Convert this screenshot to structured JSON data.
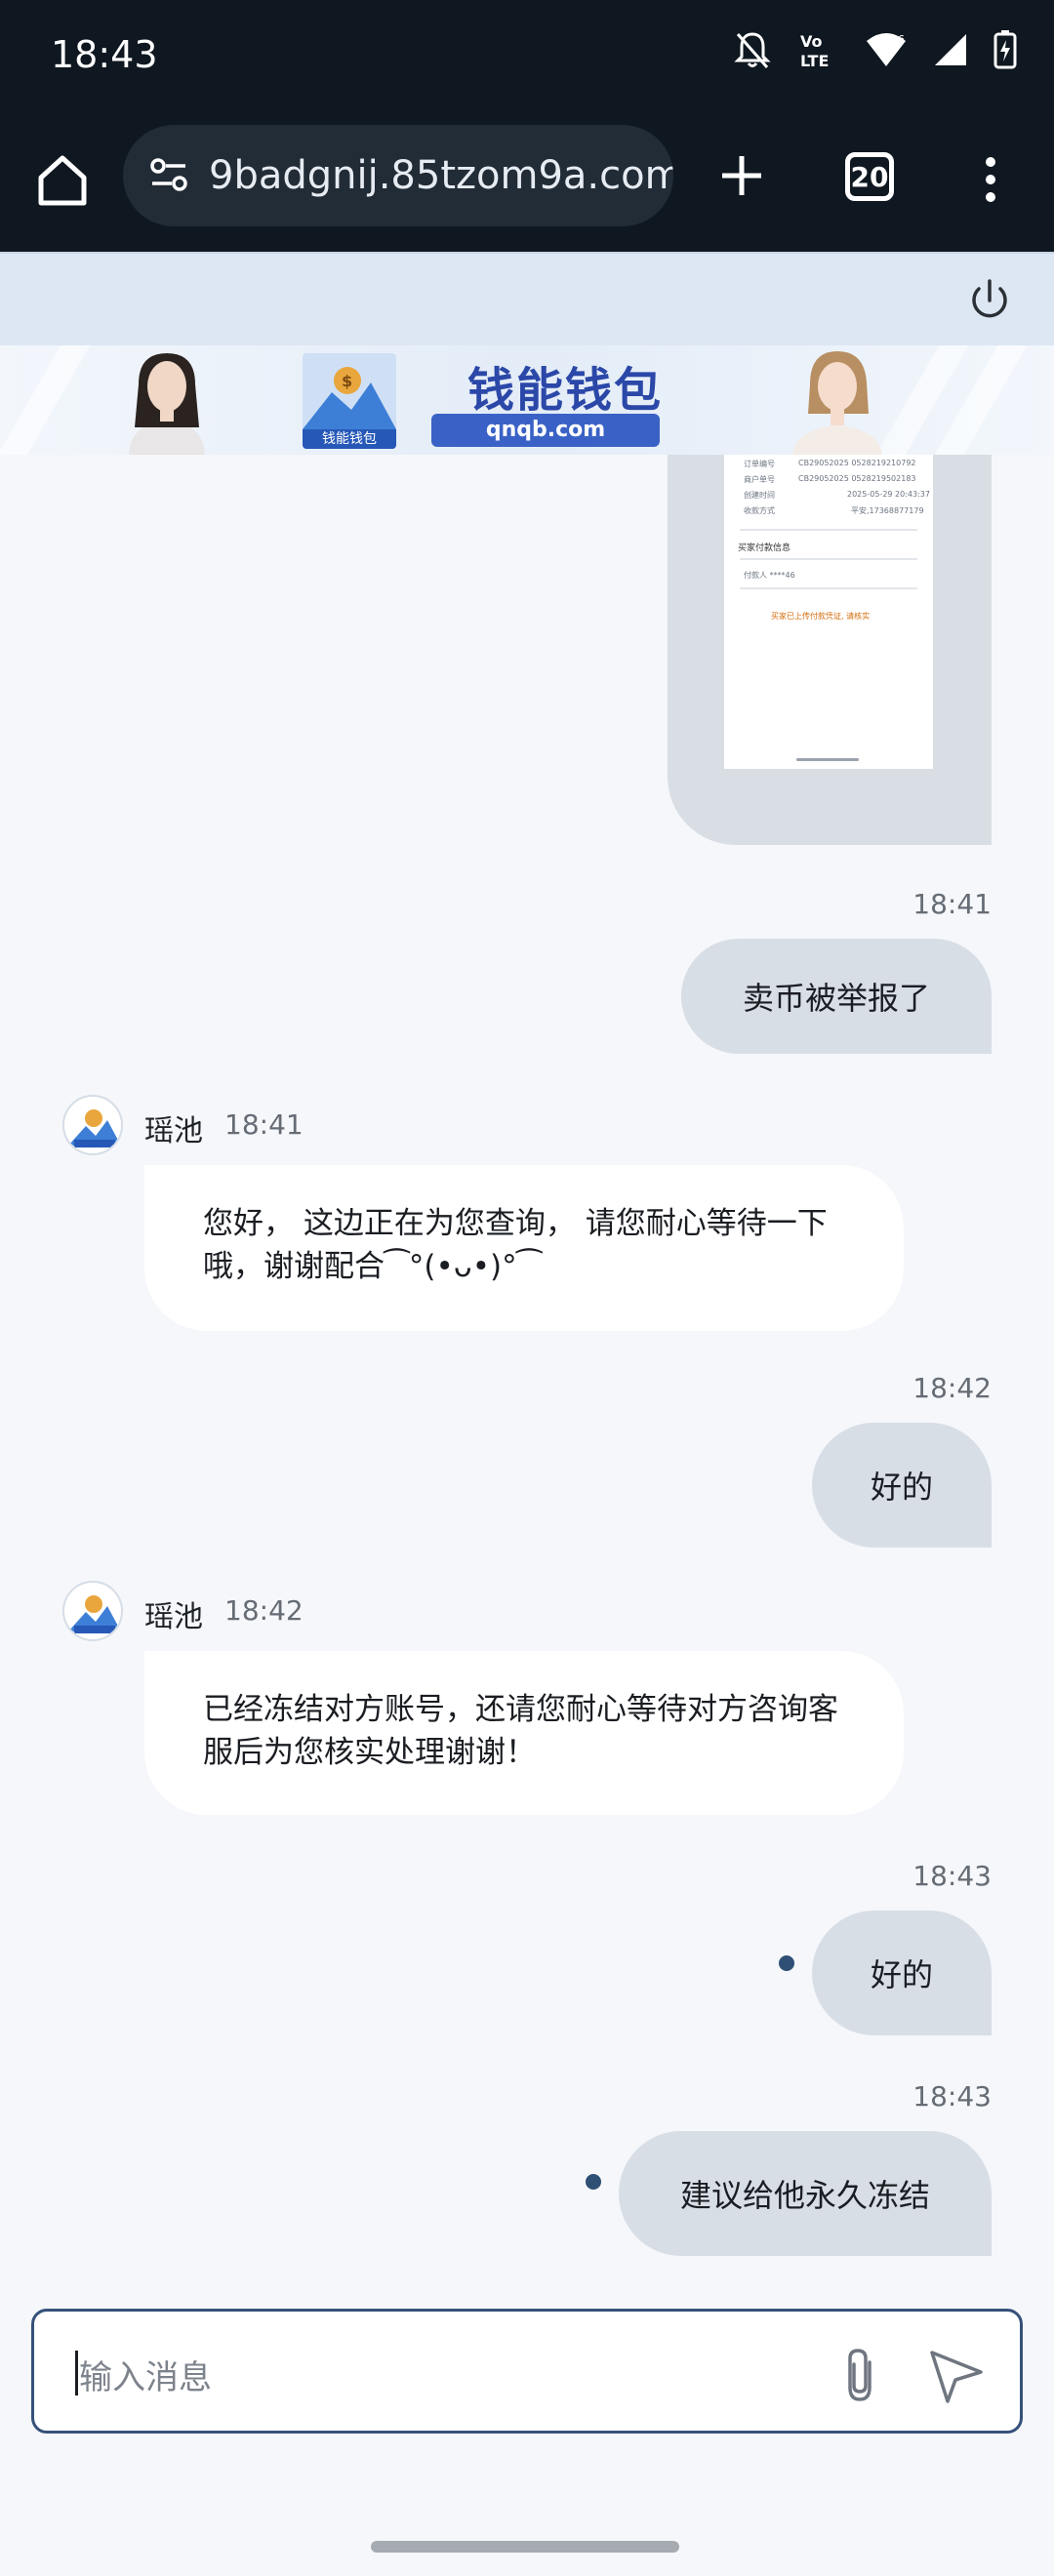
{
  "status_bar": {
    "time": "18:43",
    "icons": [
      "notifications-off-icon",
      "volte-icon",
      "wifi-icon",
      "signal-icon",
      "battery-icon"
    ],
    "volte_label": "Vo LTE"
  },
  "browser": {
    "url": "9badgnij.85tzom9a.com",
    "tab_count": "20",
    "icons": [
      "home-icon",
      "site-settings-icon",
      "plus-icon",
      "tabs-icon",
      "more-vert-icon"
    ]
  },
  "banner": {
    "brand": "钱能钱包",
    "url": "qnqb.com",
    "logo_caption": "钱能钱包"
  },
  "screenshot_texts": {
    "rows": [
      "CB29052025 0528219210792",
      "CB29052025 0528219502183",
      "2025-05-29 20:43:37",
      "平安,17368877179"
    ],
    "section": "买家付款信息",
    "payer": "付款人 ****46",
    "warning": "买家已上传付款凭证, 请核实"
  },
  "messages": [
    {
      "side": "right",
      "type": "image"
    },
    {
      "side": "right",
      "time": "18:41",
      "text": "卖币被举报了"
    },
    {
      "side": "left",
      "sender": "瑶池",
      "time": "18:41",
      "text": "您好， 这边正在为您查询， 请您耐心等待一下哦，谢谢配合⁀°(•ᴗ•)°⁀"
    },
    {
      "side": "right",
      "time": "18:42",
      "text": "好的"
    },
    {
      "side": "left",
      "sender": "瑶池",
      "time": "18:42",
      "text": "已经冻结对方账号，还请您耐心等待对方咨询客服后为您核实处理谢谢！"
    },
    {
      "side": "right",
      "time": "18:43",
      "text": "好的",
      "unread_dot": true
    },
    {
      "side": "right",
      "time": "18:43",
      "text": "建议给他永久冻结",
      "unread_dot": true
    }
  ],
  "input": {
    "placeholder": "输入消息"
  },
  "colors": {
    "status_bg": "#0f1720",
    "outgoing_bubble": "#d8dee6",
    "incoming_bubble": "#ffffff",
    "input_border": "#36517a",
    "brand_blue": "#2b48a8"
  }
}
